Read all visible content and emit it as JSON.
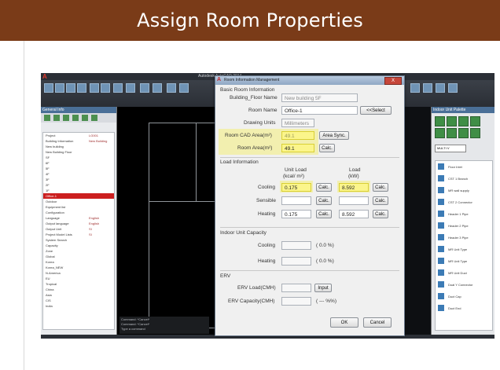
{
  "header": {
    "title": "Assign Room Properties"
  },
  "cad": {
    "window_title": "Autodesk AutoCAD 2014",
    "left_panel_title": "General Info",
    "right_panel_title": "Indoor Unit Palette",
    "tree": [
      {
        "name": "Project",
        "value": "LG001"
      },
      {
        "name": "Building Information",
        "value": "New Building"
      },
      {
        "name": "New building",
        "value": ""
      },
      {
        "name": "New Building Floor",
        "value": ""
      },
      {
        "name": "SF",
        "value": ""
      },
      {
        "name": "6F",
        "value": ""
      },
      {
        "name": "5F",
        "value": ""
      },
      {
        "name": "4F",
        "value": ""
      },
      {
        "name": "3F",
        "value": ""
      },
      {
        "name": "2F",
        "value": ""
      },
      {
        "name": "1F",
        "value": ""
      },
      {
        "name": "Office-1",
        "value": ""
      },
      {
        "name": "Outdoor",
        "value": ""
      },
      {
        "name": "Equipment list",
        "value": ""
      },
      {
        "name": "Configuration",
        "value": ""
      },
      {
        "name": "Language",
        "value": "English"
      },
      {
        "name": "Output language",
        "value": "English"
      },
      {
        "name": "Output Unit",
        "value": "SI"
      },
      {
        "name": "Project Model Lists",
        "value": "SI"
      },
      {
        "name": "System Search",
        "value": ""
      },
      {
        "name": "Capacity",
        "value": ""
      },
      {
        "name": "Zone",
        "value": ""
      },
      {
        "name": "Global",
        "value": ""
      },
      {
        "name": "Korea",
        "value": ""
      },
      {
        "name": "Korea_NEW",
        "value": ""
      },
      {
        "name": "N.America",
        "value": ""
      },
      {
        "name": "EU",
        "value": ""
      },
      {
        "name": "Tropical",
        "value": ""
      },
      {
        "name": "China",
        "value": ""
      },
      {
        "name": "Asia",
        "value": ""
      },
      {
        "name": "CIS",
        "value": ""
      },
      {
        "name": "India",
        "value": ""
      }
    ],
    "palette_combo": "MULTI V",
    "palette_items": [
      "Floor Inlet",
      "CST 1 Branch",
      "MR wall supply",
      "CST 2 Connector",
      "Header 1 Pipe",
      "Header 2 Pipe",
      "Header 3 Pipe",
      "MR Unit Type",
      "MR Unit Type",
      "MR Unit Duct",
      "Dual Y Connector",
      "Duct Cap",
      "Duct End"
    ],
    "command_lines": [
      "Command: *Cancel*",
      "Command: *Cancel*",
      "Type a command"
    ]
  },
  "dialog": {
    "title": "Room Information Management",
    "close": "X",
    "section_basic": "Basic Room Information",
    "building_floor_label": "Building_Floor Name",
    "building_floor_value": "New building 5F",
    "room_name_label": "Room Name",
    "room_name_value": "Office-1",
    "select_btn": "<<Select",
    "drawing_units_label": "Drawing Units",
    "drawing_units_value": "Millimeters",
    "cad_area_label": "Room CAD Area(m²)",
    "cad_area_value": "49.1",
    "area_sync_btn": "Area Sync.",
    "room_area_label": "Room Area(m²)",
    "room_area_value": "49.1",
    "calc_btn": "Calc.",
    "section_load": "Load Information",
    "unit_load_header": "Unit Load",
    "unit_load_unit": "(kcal/ m²)",
    "load_header": "Load",
    "load_unit": "(kW)",
    "cooling_label": "Cooling",
    "cooling_unit_load": "0.175",
    "cooling_load": "8.592",
    "sensible_label": "Sensible",
    "sensible_unit_load": "",
    "sensible_load": "",
    "heating_label": "Heating",
    "heating_unit_load": "0.175",
    "heating_load": "8.592",
    "section_capacity": "Indoor Unit Capacity",
    "cap_cooling_label": "Cooling",
    "cap_cooling_pct": "( 0.0 %)",
    "cap_heating_label": "Heating",
    "cap_heating_pct": "( 0.0 %)",
    "section_erv": "ERV",
    "erv_load_label": "ERV Load(CMH)",
    "erv_input_btn": "Input",
    "erv_cap_label": "ERV Capacity(CMH)",
    "erv_cap_pct": "( --- %%)",
    "ok_btn": "OK",
    "cancel_btn": "Cancel"
  },
  "colors": {
    "header_bg": "#7a3b18",
    "highlight": "#fbf58b"
  }
}
